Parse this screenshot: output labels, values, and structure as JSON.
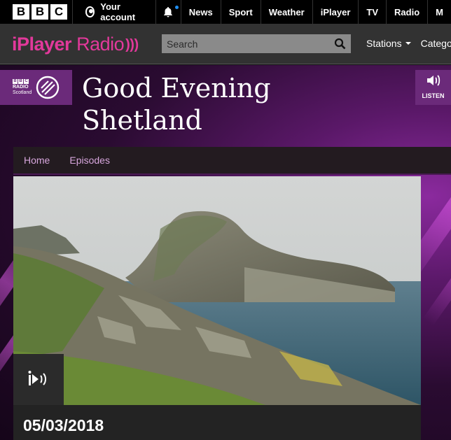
{
  "bbc": {
    "logo_letters": [
      "B",
      "B",
      "C"
    ],
    "account_label": "Your account",
    "nav": [
      "News",
      "Sport",
      "Weather",
      "iPlayer",
      "TV",
      "Radio",
      "M"
    ]
  },
  "iplayer_radio": {
    "logo_prefix": "iPlayer",
    "logo_suffix": "Radio",
    "search_placeholder": "Search",
    "nav": {
      "stations": "Stations",
      "categories": "Categori"
    }
  },
  "station": {
    "logo_lines": [
      "RADIO",
      "Scotland"
    ],
    "listen_label": "LISTEN",
    "accent": "#6b2a7a"
  },
  "programme": {
    "title_line1": "Good Evening",
    "title_line2": "Shetland",
    "subnav": {
      "home": "Home",
      "episodes": "Episodes"
    },
    "episode_date": "05/03/2018"
  },
  "colors": {
    "pink": "#e2399b",
    "subnav_link": "#d7a6dd"
  }
}
